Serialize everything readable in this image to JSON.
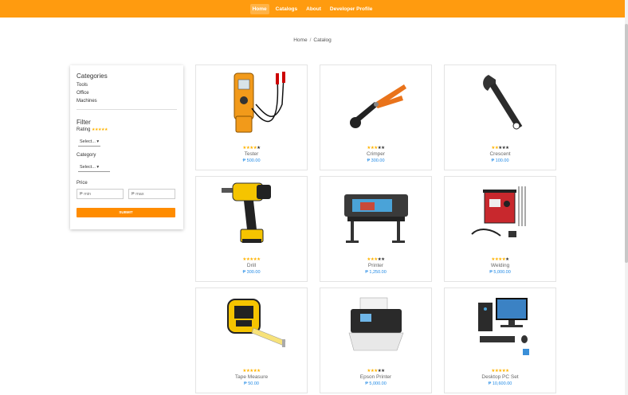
{
  "nav": {
    "links": [
      {
        "label": "Home",
        "active": true
      },
      {
        "label": "Catalogs",
        "active": false
      },
      {
        "label": "About",
        "active": false
      },
      {
        "label": "Developer Profile",
        "active": false
      }
    ]
  },
  "breadcrumb": {
    "home": "Home",
    "separator": "/",
    "current": "Catalog"
  },
  "sidebar": {
    "categories_heading": "Categories",
    "categories": [
      "Tools",
      "Office",
      "Machines"
    ],
    "filter_heading": "Filter",
    "rating_label": "Rating",
    "rating_stars": "★★★★★",
    "rating_select": "Select...",
    "category_label": "Category",
    "category_select": "Select...",
    "price_label": "Price",
    "price_min_placeholder": "₱ min",
    "price_max_placeholder": "₱ max",
    "submit_label": "SUBMIT"
  },
  "products": [
    {
      "name": "Tester",
      "price": "₱ 500.00",
      "rating": 4,
      "icon": "multimeter-icon"
    },
    {
      "name": "Crimper",
      "price": "₱ 300.00",
      "rating": 3,
      "icon": "crimper-icon"
    },
    {
      "name": "Crescent",
      "price": "₱ 100.00",
      "rating": 2,
      "icon": "wrench-icon"
    },
    {
      "name": "Drill",
      "price": "₱ 300.00",
      "rating": 5,
      "icon": "drill-icon"
    },
    {
      "name": "Printer",
      "price": "₱ 1,250.00",
      "rating": 3,
      "icon": "large-printer-icon"
    },
    {
      "name": "Welding",
      "price": "₱ 5,000.00",
      "rating": 4,
      "icon": "welder-icon"
    },
    {
      "name": "Tape Measure",
      "price": "₱ 50.00",
      "rating": 5,
      "icon": "tape-measure-icon"
    },
    {
      "name": "Epson Printer",
      "price": "₱ 5,000.00",
      "rating": 3,
      "icon": "printer-icon"
    },
    {
      "name": "Desktop PC Set",
      "price": "₱ 10,600.00",
      "rating": 5,
      "icon": "desktop-pc-icon"
    }
  ],
  "colors": {
    "accent": "#ff9b0f",
    "button": "#ff8c00",
    "price": "#1e88e5",
    "star": "#ffb300"
  }
}
